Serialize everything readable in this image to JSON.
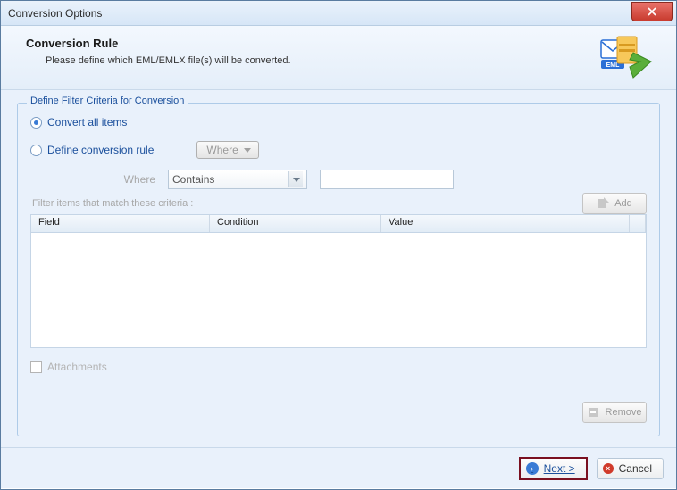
{
  "window": {
    "title": "Conversion Options"
  },
  "header": {
    "title": "Conversion Rule",
    "subtitle": "Please define which EML/EMLX file(s) will be converted."
  },
  "fieldset": {
    "legend": "Define Filter Criteria for Conversion",
    "radio_all": "Convert all items",
    "radio_rule": "Define conversion rule",
    "where_btn": "Where",
    "where_label": "Where",
    "condition_selected": "Contains",
    "value_input": "",
    "add_label": "Add",
    "criteria_label": "Filter items that match these criteria :",
    "columns": {
      "field": "Field",
      "condition": "Condition",
      "value": "Value"
    },
    "attachments_label": "Attachments",
    "remove_label": "Remove"
  },
  "footer": {
    "next": "Next >",
    "cancel": "Cancel"
  }
}
